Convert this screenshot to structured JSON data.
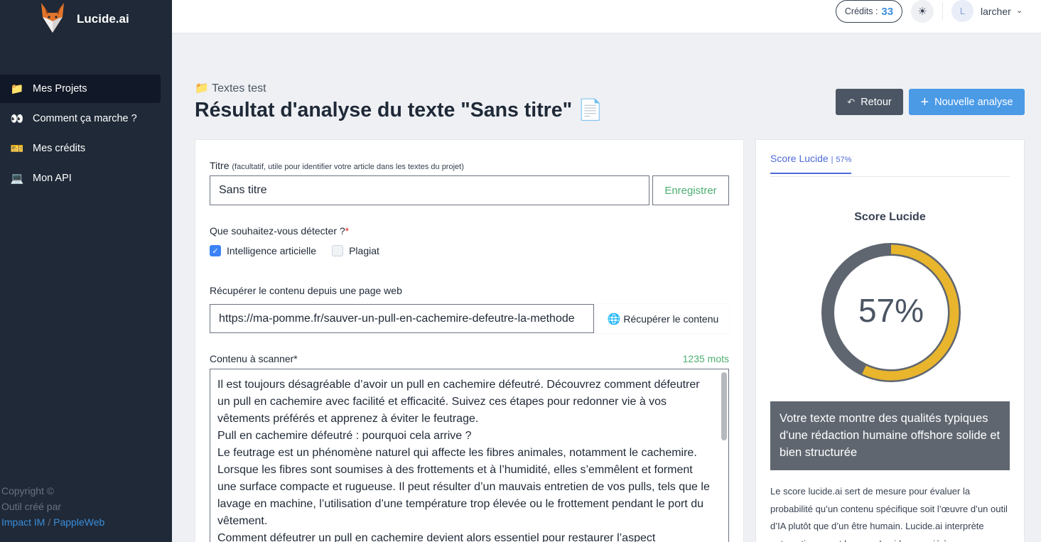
{
  "app": {
    "name": "Lucide.ai"
  },
  "sidebar": {
    "items": [
      {
        "icon": "folder-icon",
        "glyph": "📁",
        "label": "Mes Projets",
        "active": true
      },
      {
        "icon": "eyes-icon",
        "glyph": "👀",
        "label": "Comment ça marche ?",
        "active": false
      },
      {
        "icon": "ticket-icon",
        "glyph": "🎫",
        "label": "Mes crédits",
        "active": false
      },
      {
        "icon": "laptop-icon",
        "glyph": "💻",
        "label": "Mon API",
        "active": false
      }
    ],
    "copyright": {
      "line1": "Copyright ©",
      "line2": "Outil créé par",
      "link1": "Impact IM",
      "separator": "/",
      "link2": "PappleWeb"
    }
  },
  "topbar": {
    "credits_label": "Crédits :",
    "credits_value": "33",
    "avatar_letter": "L",
    "username": "larcher"
  },
  "header": {
    "breadcrumb": "📁 Textes test",
    "title": "Résultat d'analyse du texte \"Sans titre\" 📄",
    "back_label": "Retour",
    "new_label": "Nouvelle analyse"
  },
  "form": {
    "title_label": "Titre",
    "title_hint": "(facultatif, utile pour identifier votre article dans les textes du projet)",
    "title_value": "Sans titre",
    "save_label": "Enregistrer",
    "detect_label": "Que souhaitez-vous détecter ?",
    "detect_required": "*",
    "options": [
      {
        "label": "Intelligence articielle",
        "checked": true
      },
      {
        "label": "Plagiat",
        "checked": false
      }
    ],
    "url_label": "Récupérer le contenu depuis une page web",
    "url_value": "https://ma-pomme.fr/sauver-un-pull-en-cachemire-defeutre-la-methode",
    "fetch_label": "Récupérer le contenu",
    "content_label": "Contenu à scanner*",
    "word_count": "1235 mots",
    "content_lines": [
      "Il est toujours désagréable d’avoir un pull en cachemire défeutré. Découvrez comment défeutrer un pull en cachemire avec facilité et efficacité. Suivez ces étapes pour redonner vie à vos vêtements préférés et apprenez à éviter le feutrage.",
      "Pull en cachemire défeutré : pourquoi cela arrive ?",
      "Le feutrage est un phénomène naturel qui affecte les fibres animales, notamment le cachemire. Lorsque les fibres sont soumises à des frottements et à l’humidité, elles s’emmêlent et forment une surface compacte et rugueuse. Il peut résulter d’un mauvais entretien de vos pulls, tels que le lavage en machine, l’utilisation d’une température trop élevée ou le frottement pendant le port du vêtement.",
      "Comment défeutrer un pull en cachemire devient alors essentiel pour restaurer l’aspect"
    ]
  },
  "score": {
    "tab_label": "Score Lucide",
    "tab_sep": "|",
    "tab_pct": "57%",
    "title": "Score Lucide",
    "value_text": "57%",
    "fraction": 0.57,
    "colors": {
      "fill": "#e8b52c",
      "track": "#5f6670"
    },
    "verdict": "Votre texte montre des qualités typiques d'une rédaction humaine offshore solide et bien structurée",
    "explanation": "Le score lucide.ai sert de mesure pour évaluer la probabilité qu’un contenu spécifique soit l’œuvre d’un outil d’IA plutôt que d’un être humain. Lucide.ai interprète automatiquement le score Lucide associé à"
  }
}
